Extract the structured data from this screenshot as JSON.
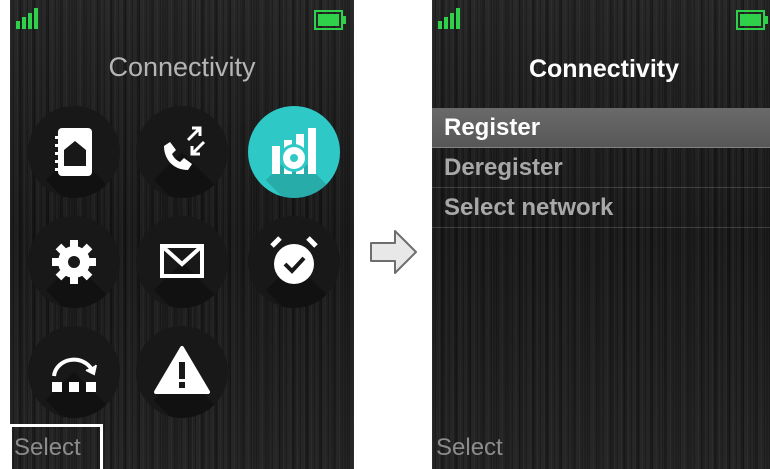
{
  "left_screen": {
    "title": "Connectivity",
    "softkey_label": "Select",
    "icons": [
      {
        "name": "contacts-icon",
        "active": false
      },
      {
        "name": "calls-icon",
        "active": false
      },
      {
        "name": "connectivity-icon",
        "active": true
      },
      {
        "name": "settings-icon",
        "active": false
      },
      {
        "name": "messaging-icon",
        "active": false
      },
      {
        "name": "alarm-clock-icon",
        "active": false
      },
      {
        "name": "rotation-icon",
        "active": false
      },
      {
        "name": "warning-icon",
        "active": false
      }
    ]
  },
  "right_screen": {
    "title": "Connectivity",
    "menu_items": [
      "Register",
      "Deregister",
      "Select network"
    ],
    "selected_index": 0,
    "softkey_label": "Select"
  },
  "colors": {
    "accent": "#2ec9c6",
    "status_green": "#2fd14a",
    "selected_row": "#5f5f5f"
  }
}
